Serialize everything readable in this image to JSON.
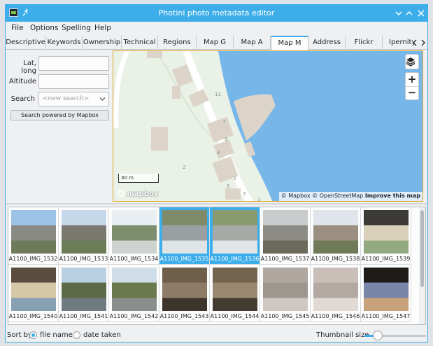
{
  "window": {
    "title": "Photini photo metadata editor",
    "accent": "#3daee9"
  },
  "titlebar": {
    "app_icon": "photini-app-icon",
    "pin_icon": "pin-icon",
    "buttons": [
      "minimize",
      "maximize",
      "close"
    ]
  },
  "menu": [
    "File",
    "Options",
    "Spelling",
    "Help"
  ],
  "tabs": [
    "Descriptive",
    "Keywords",
    "Ownership",
    "Technical",
    "Regions",
    "Map G",
    "Map A",
    "Map M",
    "Address",
    "Flickr",
    "Ipernity"
  ],
  "active_tab": "Map M",
  "left_panel": {
    "latlong_label": "Lat, long",
    "latlong_value": "",
    "altitude_label": "Altitude",
    "altitude_value": "",
    "search_label": "Search",
    "search_placeholder": "<new search>",
    "search_powered_label": "Search powered by Mapbox"
  },
  "map": {
    "zoom_in": "+",
    "zoom_out": "−",
    "layers_icon": "layers-icon",
    "scale_label": "30 m",
    "logo_text": "mapbox",
    "attribution_mapbox": "© Mapbox",
    "attribution_osm": "© OpenStreetMap",
    "attribution_improve": "Improve this map",
    "building_numbers": [
      "11",
      "7",
      "9",
      "3",
      "2",
      "3",
      "5",
      "3",
      "1"
    ],
    "colors": {
      "water": "#77b6e9",
      "land": "#eaf1e6",
      "building": "#dcd4c8",
      "road": "#ffffff"
    }
  },
  "thumbnails": [
    {
      "name": "A1100_IMG_1532",
      "selected": false
    },
    {
      "name": "A1100_IMG_1533",
      "selected": false
    },
    {
      "name": "A1100_IMG_1534",
      "selected": false
    },
    {
      "name": "A1100_IMG_1535",
      "selected": true
    },
    {
      "name": "A1100_IMG_1536",
      "selected": true
    },
    {
      "name": "A1100_IMG_1537",
      "selected": false
    },
    {
      "name": "A1100_IMG_1538",
      "selected": false
    },
    {
      "name": "A1100_IMG_1539",
      "selected": false
    },
    {
      "name": "A1100_IMG_1540",
      "selected": false
    },
    {
      "name": "A1100_IMG_1541",
      "selected": false
    },
    {
      "name": "A1100_IMG_1542",
      "selected": false
    },
    {
      "name": "A1100_IMG_1543",
      "selected": false
    },
    {
      "name": "A1100_IMG_1544",
      "selected": false
    },
    {
      "name": "A1100_IMG_1545",
      "selected": false
    },
    {
      "name": "A1100_IMG_1546",
      "selected": false
    },
    {
      "name": "A1100_IMG_1547",
      "selected": false
    }
  ],
  "status": {
    "sort_by_label": "Sort by",
    "sort_file_name": "file name",
    "sort_date_taken": "date taken",
    "sort_selected": "file name",
    "thumbnail_size_label": "Thumbnail size",
    "thumbnail_size_level": 0.22
  }
}
